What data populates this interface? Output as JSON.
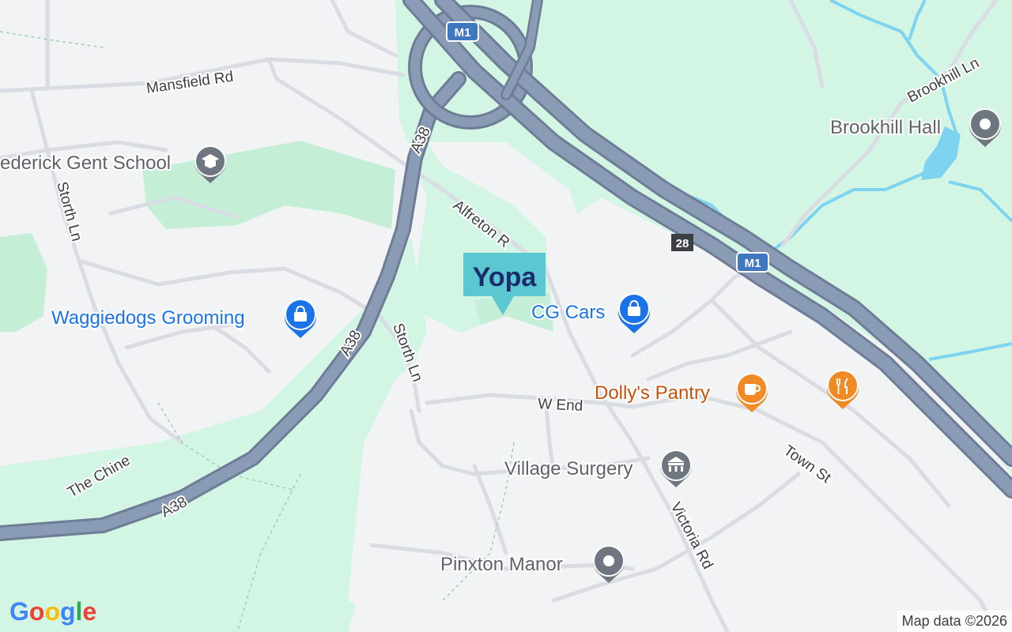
{
  "map": {
    "motorway_shields": [
      "M1",
      "M1"
    ],
    "junction_number": "28",
    "roads": {
      "mansfield_rd": "Mansfield Rd",
      "a38_north": "A38",
      "a38_mid": "A38",
      "a38_south": "A38",
      "alfreton_rd": "Alfreton R",
      "storth_ln_west": "Storth Ln",
      "storth_ln_mid": "Storth Ln",
      "the_chine": "The Chine",
      "w_end": "W End",
      "town_st": "Town St",
      "victoria_rd": "Victoria Rd",
      "brookhill_ln": "Brookhill Ln"
    },
    "pois": {
      "school": "ederick Gent School",
      "grooming": "Waggiedogs Grooming",
      "cg_cars": "CG Cars",
      "brookhill_hall": "Brookhill Hall",
      "dollys_pantry": "Dolly's Pantry",
      "village_surgery": "Village Surgery",
      "pinxton_manor": "Pinxton Manor"
    },
    "marker": {
      "brand": "Yopa",
      "color": "#5bc8d1"
    },
    "icons": {
      "school": "school-icon",
      "shop": "shopping-bag-icon",
      "place": "place-pin-icon",
      "cafe": "cafe-cup-icon",
      "restaurant": "restaurant-icon",
      "medical": "medical-building-icon"
    },
    "colors": {
      "motorway": "#8a9bb5",
      "park": "#d3f5e3",
      "water": "#7dd3f0",
      "poi_blue": "#1a73e8",
      "poi_orange": "#f08a24",
      "poi_grey": "#6e7680"
    }
  },
  "branding": {
    "google_letters": [
      "G",
      "o",
      "o",
      "g",
      "l",
      "e"
    ],
    "attribution": "Map data ©2026"
  }
}
